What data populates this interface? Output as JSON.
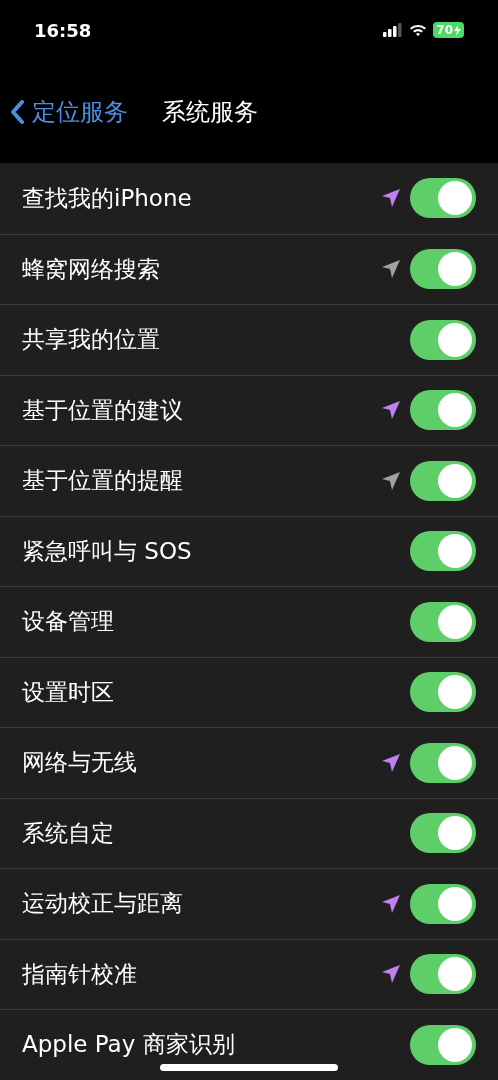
{
  "status_bar": {
    "time": "16:58",
    "battery": "70",
    "charging": true
  },
  "nav": {
    "back": "定位服务",
    "title": "系统服务"
  },
  "rows": [
    {
      "label": "查找我的iPhone",
      "on": true,
      "color": "#c17ff0"
    },
    {
      "label": "蜂窝网络搜索",
      "on": true,
      "color": "#a0a0a5"
    },
    {
      "label": "共享我的位置",
      "on": true
    },
    {
      "label": "基于位置的建议",
      "on": true,
      "color": "#c17ff0"
    },
    {
      "label": "基于位置的提醒",
      "on": true,
      "color": "#a0a0a5"
    },
    {
      "label": "紧急呼叫与 SOS",
      "on": true
    },
    {
      "label": "设备管理",
      "on": true
    },
    {
      "label": "设置时区",
      "on": true
    },
    {
      "label": "网络与无线",
      "on": true,
      "color": "#c17ff0"
    },
    {
      "label": "系统自定",
      "on": true
    },
    {
      "label": "运动校正与距离",
      "on": true,
      "color": "#c17ff0"
    },
    {
      "label": "指南针校准",
      "on": true,
      "color": "#c17ff0"
    },
    {
      "label": "Apple Pay 商家识别",
      "on": true
    }
  ]
}
